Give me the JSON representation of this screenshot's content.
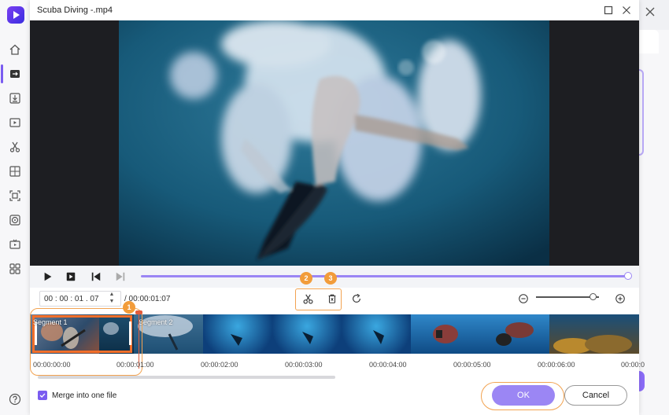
{
  "window": {
    "title": "Scuba Diving -.mp4"
  },
  "player": {
    "progress_fraction": 1.0
  },
  "editor": {
    "current_time": "00 : 00 : 01 . 07",
    "total_time": "/ 00:00:01:07",
    "zoom_fraction": 0.9
  },
  "steps": {
    "one": "1",
    "two": "2",
    "three": "3"
  },
  "timeline": {
    "segments": [
      {
        "label": "Segment 1"
      },
      {
        "label": "Segment 2"
      }
    ],
    "ticks": [
      "00:00:00:00",
      "00:00:01:00",
      "00:00:02:00",
      "00:00:03:00",
      "00:00:04:00",
      "00:00:05:00",
      "00:00:06:00",
      "00:00:0"
    ]
  },
  "footer": {
    "merge_label": "Merge into one file",
    "merge_checked": true,
    "ok_label": "OK",
    "cancel_label": "Cancel"
  },
  "colors": {
    "accent": "#9b86f4",
    "highlight": "#f2a351",
    "segment": "#f26f2a"
  },
  "icons": [
    "home-icon",
    "convert-icon",
    "download-icon",
    "video-icon",
    "cut-icon",
    "compress-icon",
    "screen-record-icon",
    "burn-icon",
    "tv-icon",
    "toolbox-icon",
    "help-icon",
    "play-icon",
    "stop-icon",
    "prev-frame-icon",
    "next-frame-icon",
    "scissors-icon",
    "delete-icon",
    "reset-icon",
    "zoom-out-icon",
    "zoom-in-icon",
    "maximize-icon",
    "close-icon"
  ]
}
